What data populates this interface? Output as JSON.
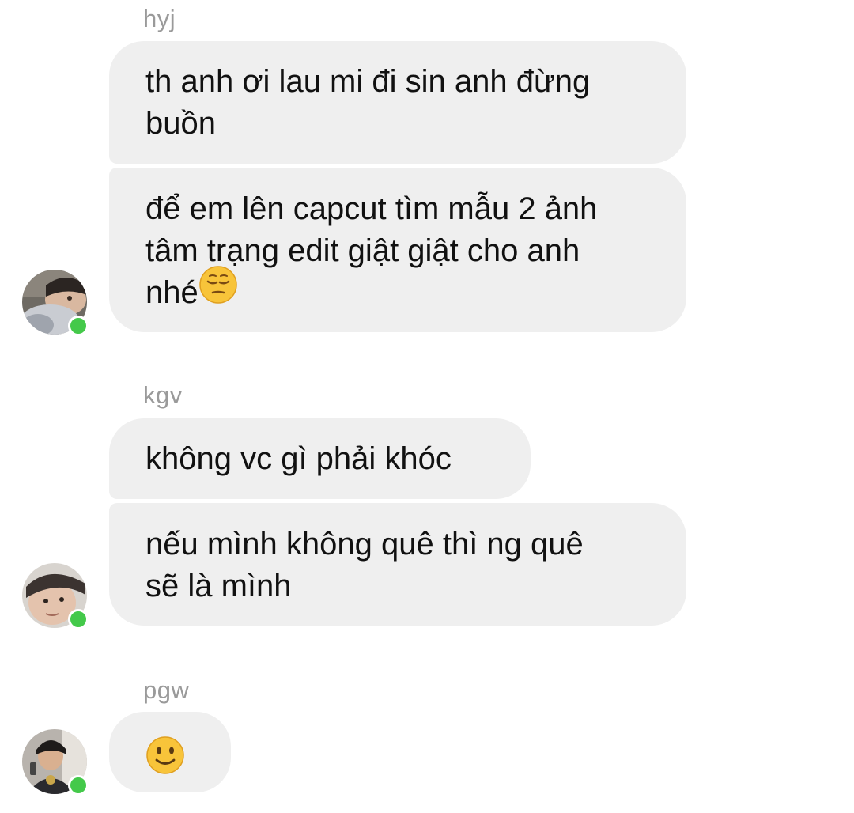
{
  "groups": [
    {
      "sender": "hyj",
      "messages": [
        "th anh ơi lau mi đi sin anh đừng\nbuồn",
        "để em lên capcut tìm mẫu 2 ảnh\ntâm trạng edit giật giật cho anh\nnhé"
      ],
      "emoji": "pensive-face",
      "online": true
    },
    {
      "sender": "kgv",
      "messages": [
        "không vc gì phải khóc",
        "nếu mình không quê thì ng quê\nsẽ là mình"
      ],
      "online": true
    },
    {
      "sender": "pgw",
      "emoji": "slightly-smiling-face",
      "online": true
    }
  ],
  "colors": {
    "bubble": "#efefef",
    "sender_name": "#9a9a9a",
    "online_dot": "#44c94a"
  }
}
